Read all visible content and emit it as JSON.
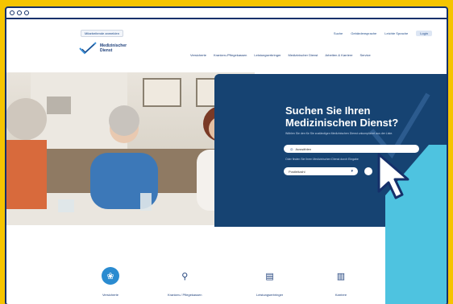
{
  "header": {
    "top_left_link": "Mitarbeitende anmelden",
    "top_right_links": [
      "Suche",
      "Gebärdensprache",
      "Leichte Sprache",
      "Login"
    ]
  },
  "logo": {
    "text": "Medizinischer\nDienst"
  },
  "main_nav": [
    "Versicherte",
    "Kranken-/Pflegekassen",
    "Leistungserbringer",
    "Medizinischer Dienst",
    "Arbeiten & Karriere",
    "Service"
  ],
  "hero": {
    "title": "Suchen Sie Ihren\nMedizinischen Dienst?",
    "subtitle": "Wählen Sie den für Sie zuständigen Medizinischen Dienst unkompliziert aus der Liste.",
    "search_value": "Auswählen",
    "subtitle2": "Oder finden Sie Ihren Medizinischen Dienst durch Eingabe",
    "select_placeholder": "Postleitzahl"
  },
  "tiles": [
    {
      "label": "Versicherte",
      "icon": "lotus-icon"
    },
    {
      "label": "Kranken-/ Pflegekassen",
      "icon": "location-pin-icon"
    },
    {
      "label": "Leistungserbringer",
      "icon": "document-icon"
    },
    {
      "label": "Karriere",
      "icon": "book-icon"
    }
  ],
  "colors": {
    "frame": "#f5c400",
    "panel": "#164372",
    "accent": "#4ec3e0",
    "brand": "#1d3f7a"
  }
}
